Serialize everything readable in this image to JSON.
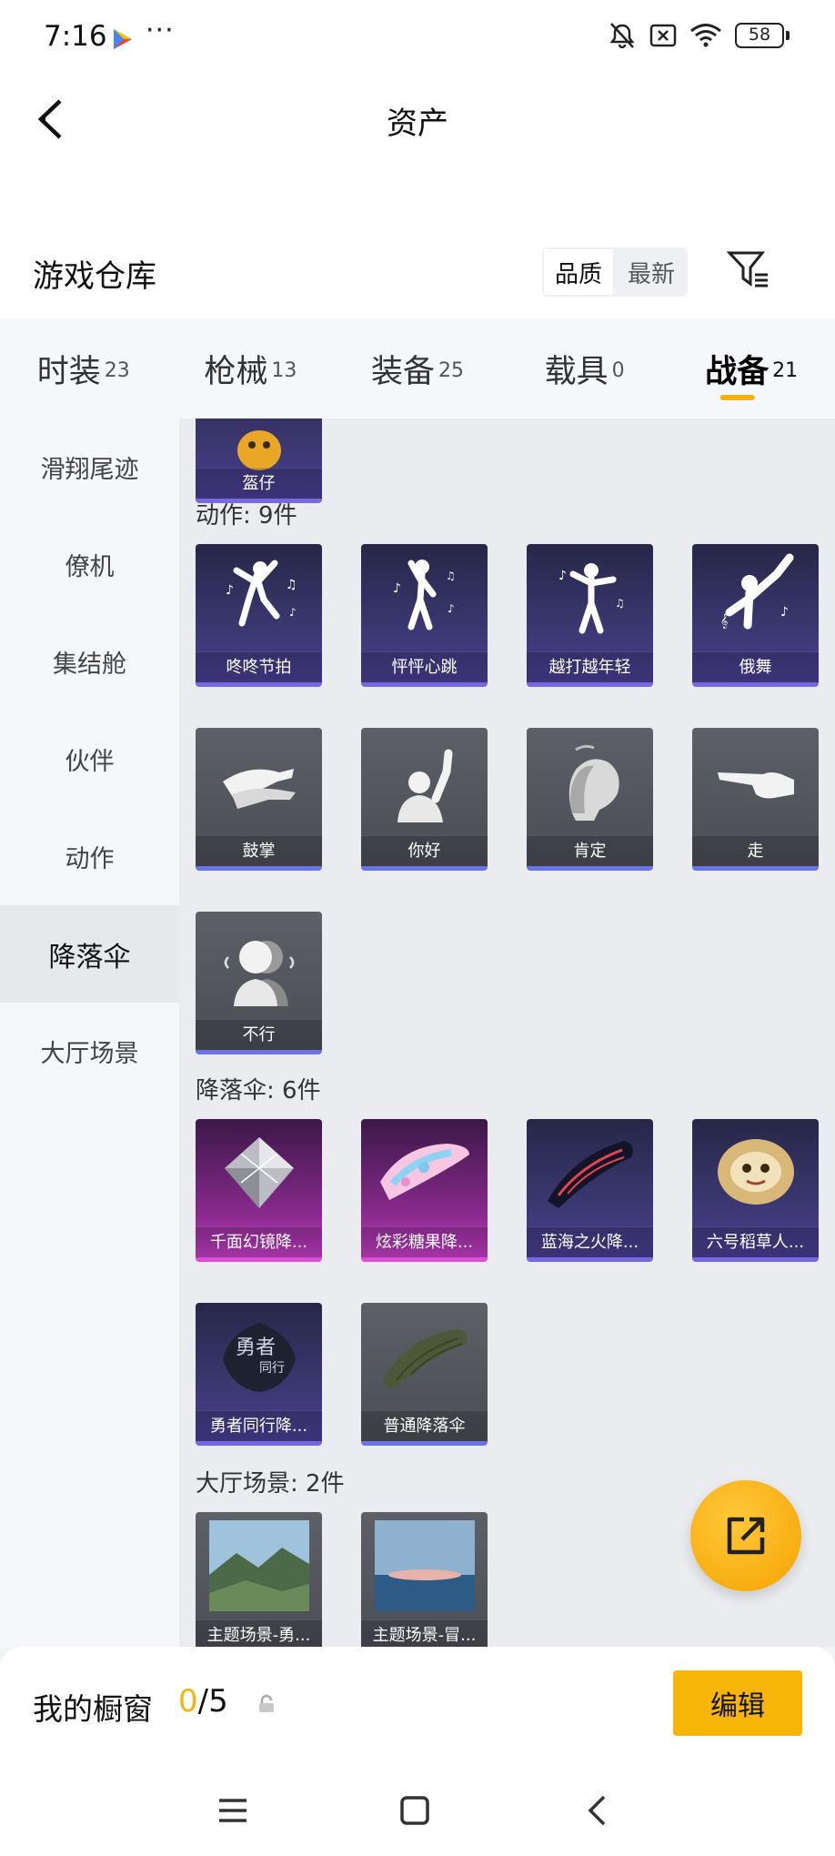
{
  "status": {
    "time": "7:16",
    "battery": "58"
  },
  "header": {
    "title": "资产"
  },
  "warehouse": {
    "title": "游戏仓库",
    "sort_quality": "品质",
    "sort_newest": "最新"
  },
  "tabs": [
    {
      "label": "时装",
      "count": "23"
    },
    {
      "label": "枪械",
      "count": "13"
    },
    {
      "label": "装备",
      "count": "25"
    },
    {
      "label": "载具",
      "count": "0"
    },
    {
      "label": "战备",
      "count": "21"
    }
  ],
  "sidebar": [
    "滑翔尾迹",
    "僚机",
    "集结舱",
    "伙伴",
    "动作",
    "降落伞",
    "大厅场景"
  ],
  "content": {
    "partial_item": "盔仔",
    "section_actions": "动作: 9件",
    "actions": [
      "咚咚节拍",
      "怦怦心跳",
      "越打越年轻",
      "俄舞",
      "鼓掌",
      "你好",
      "肯定",
      "走",
      "不行"
    ],
    "section_parachutes": "降落伞: 6件",
    "parachutes": [
      "千面幻镜降...",
      "炫彩糖果降...",
      "蓝海之火降...",
      "六号稻草人...",
      "勇者同行降...",
      "普通降落伞"
    ],
    "section_scenes": "大厅场景: 2件",
    "scenes": [
      "主题场景-勇...",
      "主题场景-冒..."
    ]
  },
  "showcase": {
    "title": "我的橱窗",
    "current": "0",
    "total": "/5",
    "edit_label": "编辑"
  },
  "colors": {
    "accent": "#f5b40d",
    "purple_card": "#3b3770",
    "gray_card": "#54565e",
    "pink_card": "#8a2a8f"
  }
}
